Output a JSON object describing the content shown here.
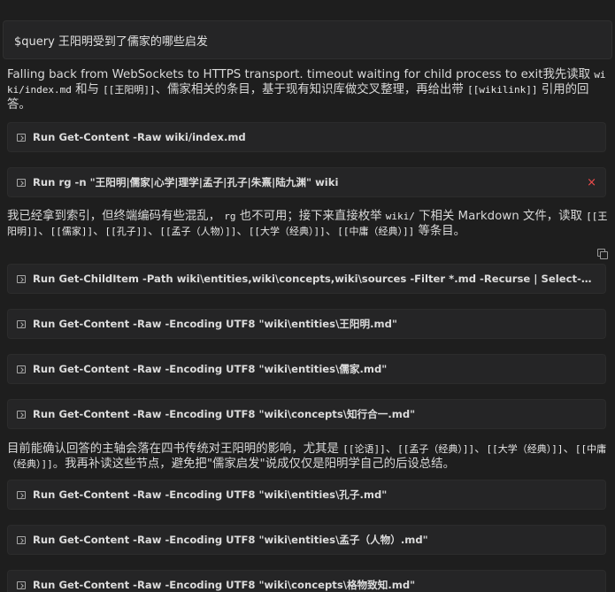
{
  "query": "$query 王阳明受到了儒家的哪些启发",
  "blocks": {
    "p1": {
      "text_a": "Falling back from WebSockets to HTTPS transport. timeout waiting for child process to exit我先读取 ",
      "code_a": "wiki/index.md",
      "text_b": " 和与 ",
      "code_b": "[[王阳明]]",
      "text_c": "、儒家相关的条目，基于现有知识库做交叉整理，再给出带 ",
      "code_c": "[[wikilink]]",
      "text_d": " 引用的回答。"
    },
    "run1": "Run Get-Content -Raw wiki/index.md",
    "run2": "Run rg -n \"王阳明|儒家|心学|理学|孟子|孔子|朱熹|陆九渊\" wiki",
    "p2": {
      "text_a": "我已经拿到索引，但终端编码有些混乱， ",
      "code_a": "rg",
      "text_b": " 也不可用；接下来直接枚举 ",
      "code_b": "wiki/",
      "text_c": " 下相关 Markdown 文件，读取 ",
      "code_c": "[[王阳明]]",
      "text_d": "、",
      "code_d": "[[儒家]]",
      "text_e": "、",
      "code_e": "[[孔子]]",
      "text_f": "、",
      "code_f": "[[孟子（人物）]]",
      "text_g": "、",
      "code_g": "[[大学（经典）]]",
      "text_h": "、",
      "code_h": "[[中庸（经典）]]",
      "text_i": " 等条目。"
    },
    "run3": "Run Get-ChildItem -Path wiki\\entities,wiki\\concepts,wiki\\sources -Filter *.md -Recurse | Select-Object -E...",
    "run4": "Run Get-Content -Raw -Encoding UTF8 \"wiki\\entities\\王阳明.md\"",
    "run5": "Run Get-Content -Raw -Encoding UTF8 \"wiki\\entities\\儒家.md\"",
    "run6": "Run Get-Content -Raw -Encoding UTF8 \"wiki\\concepts\\知行合一.md\"",
    "p3": {
      "text_a": "目前能确认回答的主轴会落在四书传统对王阳明的影响，尤其是 ",
      "code_a": "[[论语]]",
      "text_b": "、",
      "code_b": "[[孟子（经典）]]",
      "text_c": "、",
      "code_c": "[[大学（经典）]]",
      "text_d": "、",
      "code_d": "[[中庸（经典）]]",
      "text_e": "。我再补读这些节点，避免把\"儒家启发\"说成仅仅是阳明学自己的后设总结。"
    },
    "run7": "Run Get-Content -Raw -Encoding UTF8 \"wiki\\entities\\孔子.md\"",
    "run8": "Run Get-Content -Raw -Encoding UTF8 \"wiki\\entities\\孟子（人物）.md\"",
    "run9": "Run Get-Content -Raw -Encoding UTF8 \"wiki\\concepts\\格物致知.md\""
  },
  "icons": {
    "run": "terminal-icon",
    "close": "close-icon",
    "copy": "copy-icon"
  },
  "colors": {
    "background": "#1e1e1e",
    "box": "#252526",
    "close": "#f14c4c"
  }
}
